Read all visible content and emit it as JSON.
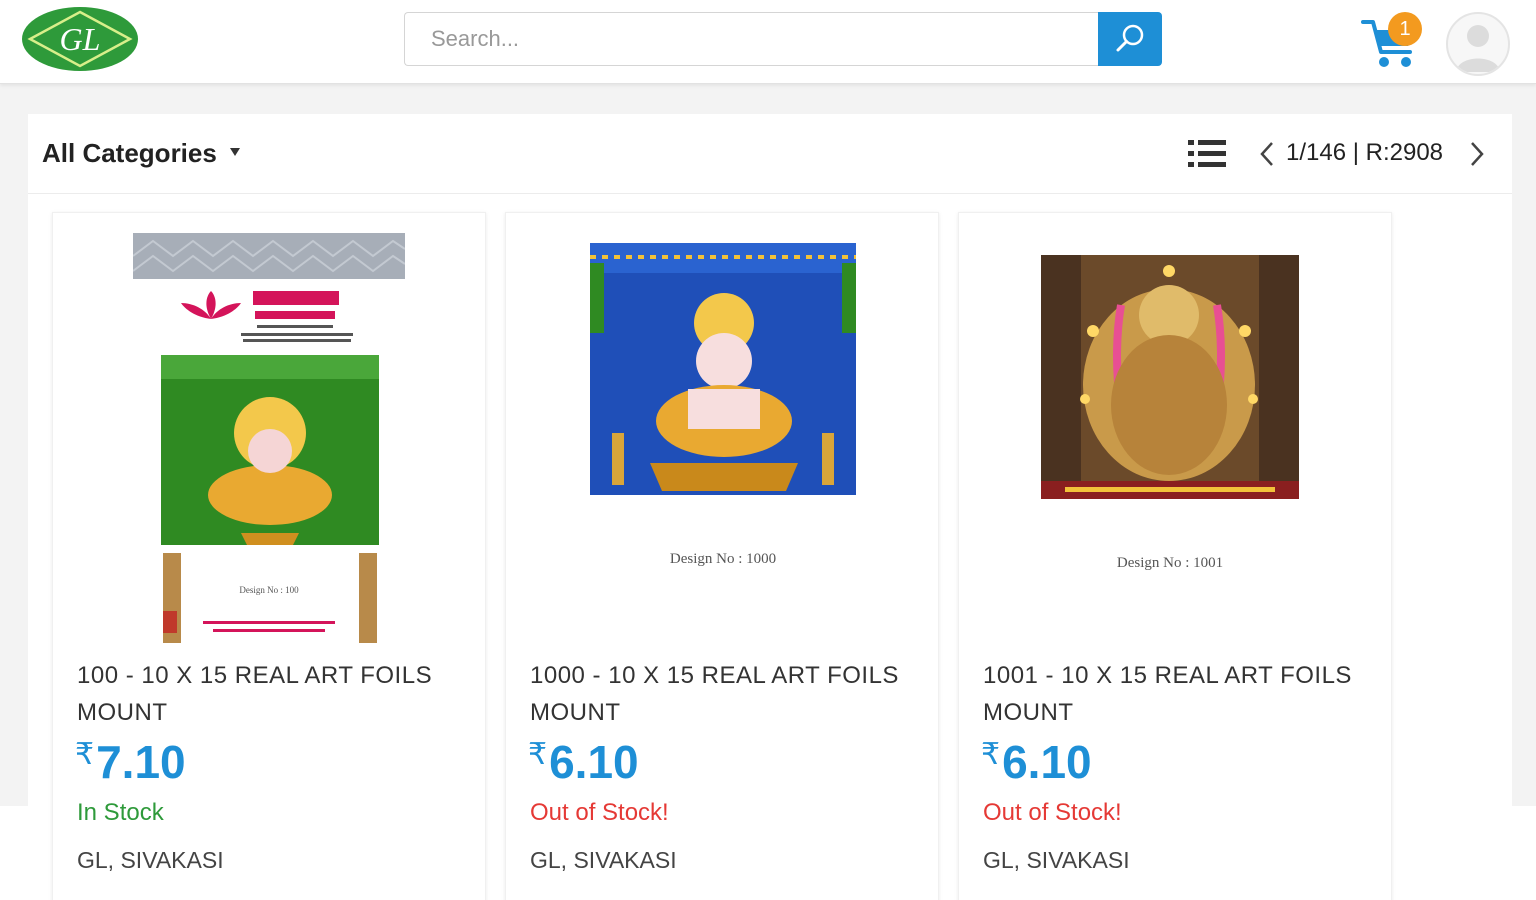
{
  "header": {
    "logo_text": "GL",
    "search_placeholder": "Search...",
    "cart_count": "1",
    "brand_green": "#2e9a3a",
    "accent_blue": "#1e8fd6",
    "badge_orange": "#f39a1f"
  },
  "toolbar": {
    "category_label": "All Categories",
    "page_info": "1/146 | R:2908"
  },
  "products": [
    {
      "title": "100 - 10 X 15 REAL ART FOILS MOUNT",
      "currency": "₹",
      "price": "7.10",
      "stock": "In Stock",
      "seller": "GL, SIVAKASI",
      "image_caption": "Design No : 100"
    },
    {
      "title": "1000 - 10 X 15 REAL ART FOILS MOUNT",
      "currency": "₹",
      "price": "6.10",
      "stock": "Out of Stock!",
      "seller": "GL, SIVAKASI",
      "image_caption": "Design No : 1000"
    },
    {
      "title": "1001 - 10 X 15 REAL ART FOILS MOUNT",
      "currency": "₹",
      "price": "6.10",
      "stock": "Out of Stock!",
      "seller": "GL, SIVAKASI",
      "image_caption": "Design No : 1001"
    }
  ]
}
